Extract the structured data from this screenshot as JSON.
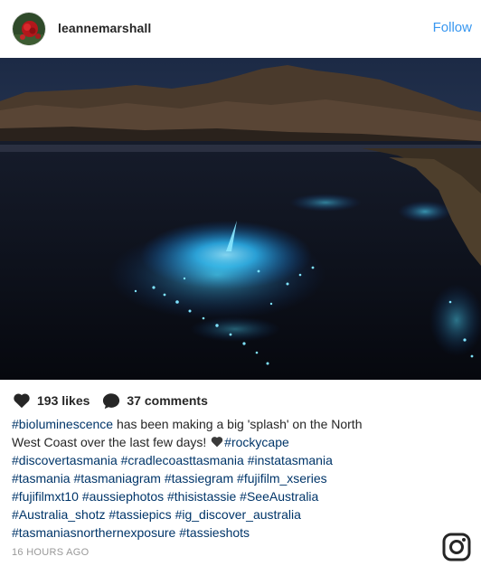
{
  "post": {
    "username": "leannemarshall",
    "follow_label": "Follow"
  },
  "stats": {
    "likes": "193 likes",
    "comments": "37 comments"
  },
  "caption": {
    "lines": [
      [
        {
          "t": "#bioluminescence",
          "tag": true
        },
        {
          "t": " has been making a big 'splash' on the North",
          "tag": false
        }
      ],
      [
        {
          "t": "West Coast over the last few days! ",
          "tag": false
        },
        {
          "t": "",
          "emoji": "black-heart-icon"
        },
        {
          "t": "#rockycape",
          "tag": true
        }
      ],
      [
        {
          "t": "#discovertasmania",
          "tag": true
        },
        {
          "t": " ",
          "tag": false
        },
        {
          "t": "#cradlecoasttasmania",
          "tag": true
        },
        {
          "t": " ",
          "tag": false
        },
        {
          "t": "#instatasmania",
          "tag": true
        }
      ],
      [
        {
          "t": "#tasmania",
          "tag": true
        },
        {
          "t": " ",
          "tag": false
        },
        {
          "t": "#tasmaniagram",
          "tag": true
        },
        {
          "t": " ",
          "tag": false
        },
        {
          "t": "#tassiegram",
          "tag": true
        },
        {
          "t": " ",
          "tag": false
        },
        {
          "t": "#fujifilm_xseries",
          "tag": true
        }
      ],
      [
        {
          "t": "#fujifilmxt10",
          "tag": true
        },
        {
          "t": " ",
          "tag": false
        },
        {
          "t": "#aussiephotos",
          "tag": true
        },
        {
          "t": " ",
          "tag": false
        },
        {
          "t": "#thisistassie",
          "tag": true
        },
        {
          "t": " ",
          "tag": false
        },
        {
          "t": "#SeeAustralia",
          "tag": true
        }
      ],
      [
        {
          "t": "#Australia_shotz",
          "tag": true
        },
        {
          "t": " ",
          "tag": false
        },
        {
          "t": "#tassiepics",
          "tag": true
        },
        {
          "t": " ",
          "tag": false
        },
        {
          "t": "#ig_discover_australia",
          "tag": true
        }
      ],
      [
        {
          "t": "#tasmaniasnorthernexposure",
          "tag": true
        },
        {
          "t": " ",
          "tag": false
        },
        {
          "t": "#tassieshots",
          "tag": true
        }
      ]
    ]
  },
  "timestamp": "16 HOURS AGO",
  "colors": {
    "link": "#3897f0",
    "hashtag": "#003569",
    "muted": "#999999",
    "text": "#262626"
  },
  "icons": {
    "like": "heart-icon",
    "comment": "comment-bubble-icon",
    "brand": "instagram-glyph-icon"
  }
}
